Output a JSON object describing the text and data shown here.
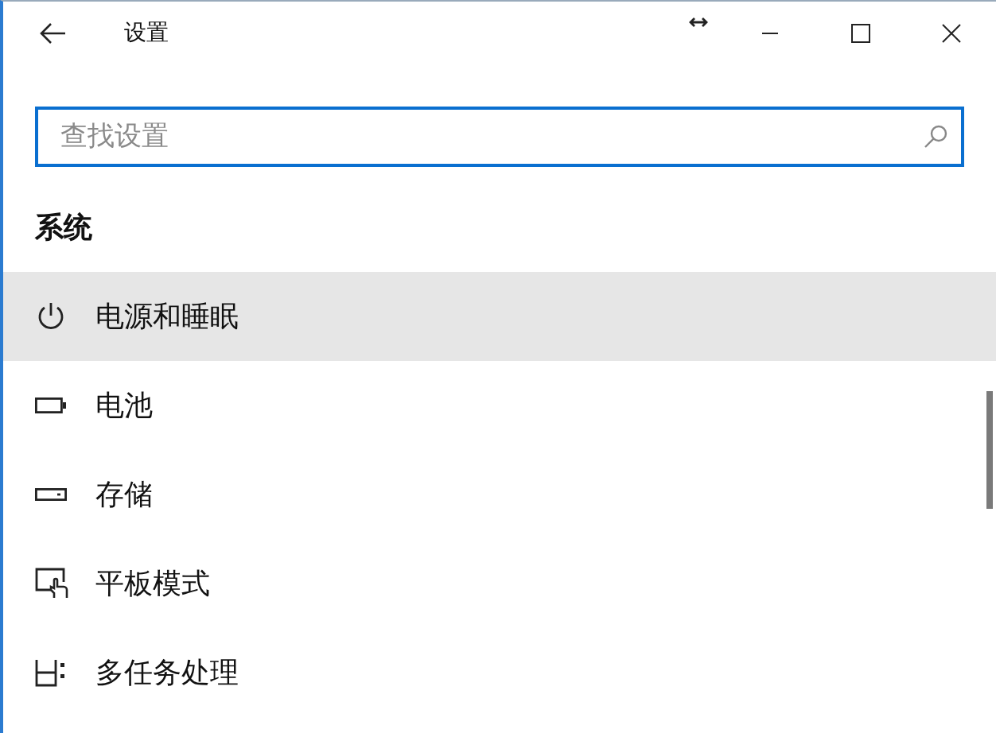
{
  "window": {
    "title": "设置"
  },
  "search": {
    "placeholder": "查找设置"
  },
  "section": {
    "title": "系统"
  },
  "items": [
    {
      "label": "电源和睡眠",
      "kind": "power",
      "selected": true
    },
    {
      "label": "电池",
      "kind": "battery",
      "selected": false
    },
    {
      "label": "存储",
      "kind": "storage",
      "selected": false
    },
    {
      "label": "平板模式",
      "kind": "tablet",
      "selected": false
    },
    {
      "label": "多任务处理",
      "kind": "multitask",
      "selected": false
    }
  ]
}
